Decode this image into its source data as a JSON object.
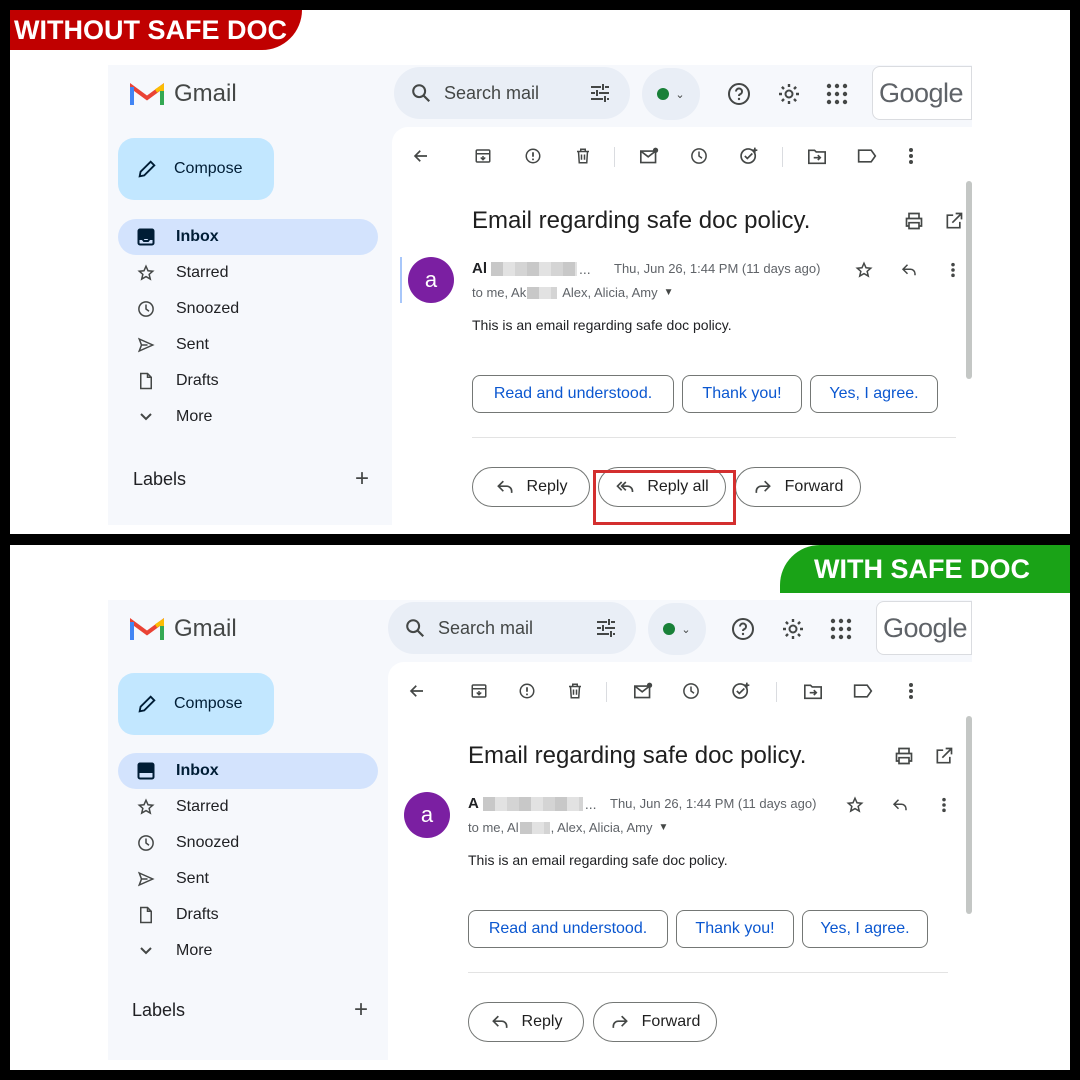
{
  "top_panel": {
    "banner": "WITHOUT SAFE DOC",
    "app_name": "Gmail",
    "search_placeholder": "Search mail",
    "google_text": "Google",
    "compose_label": "Compose",
    "nav": [
      "Inbox",
      "Starred",
      "Snoozed",
      "Sent",
      "Drafts",
      "More"
    ],
    "labels_heading": "Labels",
    "email": {
      "subject": "Email regarding safe doc policy.",
      "avatar_letter": "a",
      "sender_initial": "Al",
      "date": "Thu, Jun 26, 1:44 PM (11 days ago)",
      "to_prefix": "to me, Ak",
      "to_suffix": "Alex, Alicia, Amy",
      "body": "This is an email regarding safe doc policy.",
      "smart_replies": [
        "Read and understood.",
        "Thank you!",
        "Yes, I agree."
      ],
      "actions": [
        "Reply",
        "Reply all",
        "Forward"
      ]
    }
  },
  "bottom_panel": {
    "banner": "WITH SAFE DOC",
    "app_name": "Gmail",
    "search_placeholder": "Search mail",
    "google_text": "Google",
    "compose_label": "Compose",
    "nav": [
      "Inbox",
      "Starred",
      "Snoozed",
      "Sent",
      "Drafts",
      "More"
    ],
    "labels_heading": "Labels",
    "email": {
      "subject": "Email regarding safe doc policy.",
      "avatar_letter": "a",
      "sender_initial": "A",
      "date": "Thu, Jun 26, 1:44 PM (11 days ago)",
      "to_prefix": "to me, Al",
      "to_suffix": ", Alex, Alicia, Amy",
      "body": "This is an email regarding safe doc policy.",
      "smart_replies": [
        "Read and understood.",
        "Thank you!",
        "Yes, I agree."
      ],
      "actions": [
        "Reply",
        "Forward"
      ]
    }
  },
  "colors": {
    "without_banner": "#c00000",
    "with_banner": "#1aa317",
    "highlight": "#d32f2f",
    "avatar": "#7b1fa2",
    "smart_reply_text": "#0b57d0"
  }
}
